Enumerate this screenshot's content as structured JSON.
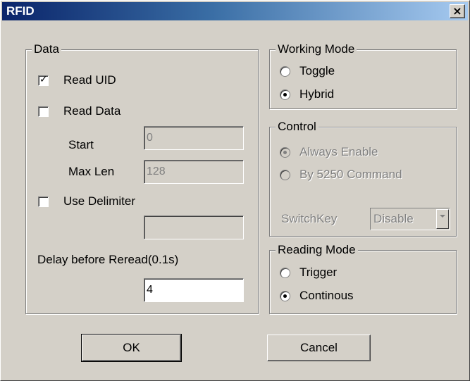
{
  "window": {
    "title": "RFID",
    "close_glyph": "×",
    "close_icon": "close-icon"
  },
  "data_group": {
    "legend": "Data",
    "read_uid": {
      "label": "Read UID",
      "checked": true
    },
    "read_data": {
      "label": "Read Data",
      "checked": false
    },
    "start_label": "Start",
    "start_value": "0",
    "max_len_label": "Max Len",
    "max_len_value": "128",
    "use_delimiter": {
      "label": "Use Delimiter",
      "checked": false
    },
    "delimiter_value": "",
    "delay_label": "Delay before Reread(0.1s)",
    "delay_value": "4"
  },
  "working_mode": {
    "legend": "Working Mode",
    "options": [
      {
        "label": "Toggle",
        "selected": false
      },
      {
        "label": "Hybrid",
        "selected": true
      }
    ]
  },
  "control": {
    "legend": "Control",
    "options": [
      {
        "label": "Always Enable",
        "selected": true
      },
      {
        "label": "By 5250 Command",
        "selected": false
      }
    ],
    "switchkey_label": "SwitchKey",
    "switchkey_value": "Disable"
  },
  "reading_mode": {
    "legend": "Reading Mode",
    "options": [
      {
        "label": "Trigger",
        "selected": false
      },
      {
        "label": "Continous",
        "selected": true
      }
    ]
  },
  "buttons": {
    "ok": "OK",
    "cancel": "Cancel"
  },
  "colors": {
    "face": "#d4d0c8",
    "title_start": "#0a246a",
    "title_end": "#a6caf0",
    "disabled_text": "#808080"
  }
}
